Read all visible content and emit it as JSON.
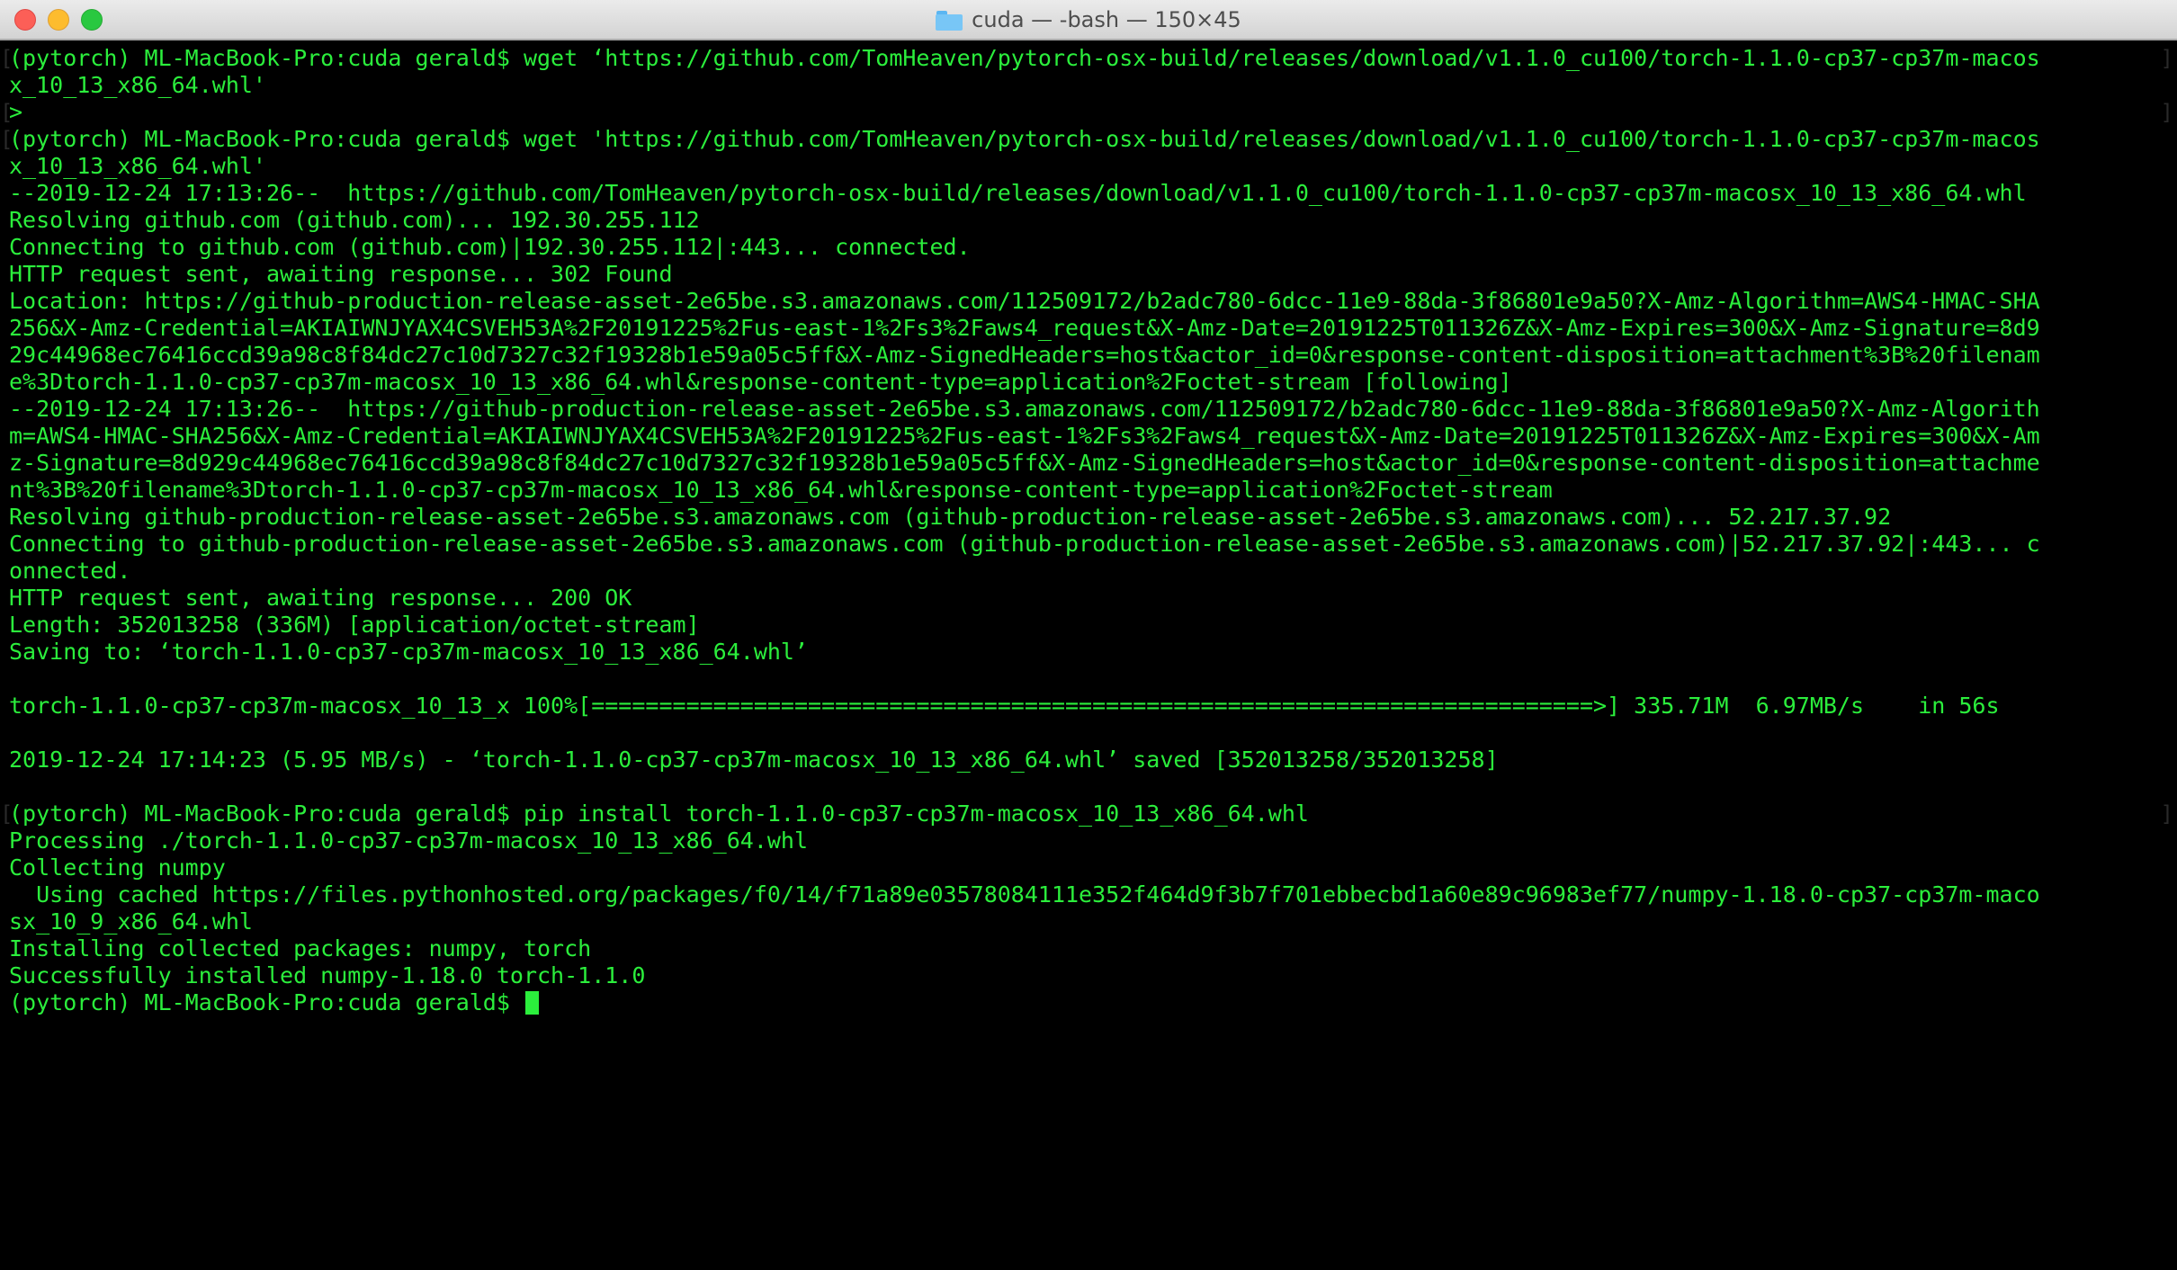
{
  "window": {
    "title": "cuda — -bash — 150×45",
    "icon": "folder-icon",
    "controls": [
      "close-button",
      "minimize-button",
      "zoom-button"
    ]
  },
  "terminal": {
    "text_color": "#2bee3c",
    "background": "#000000",
    "lines": [
      "(pytorch) ML-MacBook-Pro:cuda gerald$ wget ‘https://github.com/TomHeaven/pytorch-osx-build/releases/download/v1.1.0_cu100/torch-1.1.0-cp37-cp37m-macos",
      "x_10_13_x86_64.whl'",
      "> ",
      "(pytorch) ML-MacBook-Pro:cuda gerald$ wget 'https://github.com/TomHeaven/pytorch-osx-build/releases/download/v1.1.0_cu100/torch-1.1.0-cp37-cp37m-macos",
      "x_10_13_x86_64.whl'",
      "--2019-12-24 17:13:26--  https://github.com/TomHeaven/pytorch-osx-build/releases/download/v1.1.0_cu100/torch-1.1.0-cp37-cp37m-macosx_10_13_x86_64.whl",
      "Resolving github.com (github.com)... 192.30.255.112",
      "Connecting to github.com (github.com)|192.30.255.112|:443... connected.",
      "HTTP request sent, awaiting response... 302 Found",
      "Location: https://github-production-release-asset-2e65be.s3.amazonaws.com/112509172/b2adc780-6dcc-11e9-88da-3f86801e9a50?X-Amz-Algorithm=AWS4-HMAC-SHA",
      "256&X-Amz-Credential=AKIAIWNJYAX4CSVEH53A%2F20191225%2Fus-east-1%2Fs3%2Faws4_request&X-Amz-Date=20191225T011326Z&X-Amz-Expires=300&X-Amz-Signature=8d9",
      "29c44968ec76416ccd39a98c8f84dc27c10d7327c32f19328b1e59a05c5ff&X-Amz-SignedHeaders=host&actor_id=0&response-content-disposition=attachment%3B%20filenam",
      "e%3Dtorch-1.1.0-cp37-cp37m-macosx_10_13_x86_64.whl&response-content-type=application%2Foctet-stream [following]",
      "--2019-12-24 17:13:26--  https://github-production-release-asset-2e65be.s3.amazonaws.com/112509172/b2adc780-6dcc-11e9-88da-3f86801e9a50?X-Amz-Algorith",
      "m=AWS4-HMAC-SHA256&X-Amz-Credential=AKIAIWNJYAX4CSVEH53A%2F20191225%2Fus-east-1%2Fs3%2Faws4_request&X-Amz-Date=20191225T011326Z&X-Amz-Expires=300&X-Am",
      "z-Signature=8d929c44968ec76416ccd39a98c8f84dc27c10d7327c32f19328b1e59a05c5ff&X-Amz-SignedHeaders=host&actor_id=0&response-content-disposition=attachme",
      "nt%3B%20filename%3Dtorch-1.1.0-cp37-cp37m-macosx_10_13_x86_64.whl&response-content-type=application%2Foctet-stream",
      "Resolving github-production-release-asset-2e65be.s3.amazonaws.com (github-production-release-asset-2e65be.s3.amazonaws.com)... 52.217.37.92",
      "Connecting to github-production-release-asset-2e65be.s3.amazonaws.com (github-production-release-asset-2e65be.s3.amazonaws.com)|52.217.37.92|:443... c",
      "onnected.",
      "HTTP request sent, awaiting response... 200 OK",
      "Length: 352013258 (336M) [application/octet-stream]",
      "Saving to: ‘torch-1.1.0-cp37-cp37m-macosx_10_13_x86_64.whl’",
      "",
      "torch-1.1.0-cp37-cp37m-macosx_10_13_x 100%[==========================================================================>] 335.71M  6.97MB/s    in 56s",
      "",
      "2019-12-24 17:14:23 (5.95 MB/s) - ‘torch-1.1.0-cp37-cp37m-macosx_10_13_x86_64.whl’ saved [352013258/352013258]",
      "",
      "(pytorch) ML-MacBook-Pro:cuda gerald$ pip install torch-1.1.0-cp37-cp37m-macosx_10_13_x86_64.whl",
      "Processing ./torch-1.1.0-cp37-cp37m-macosx_10_13_x86_64.whl",
      "Collecting numpy",
      "  Using cached https://files.pythonhosted.org/packages/f0/14/f71a89e03578084111e352f464d9f3b7f701ebbecbd1a60e89c96983ef77/numpy-1.18.0-cp37-cp37m-maco",
      "sx_10_9_x86_64.whl",
      "Installing collected packages: numpy, torch",
      "Successfully installed numpy-1.18.0 torch-1.1.0"
    ],
    "prompt": "(pytorch) ML-MacBook-Pro:cuda gerald$ "
  }
}
